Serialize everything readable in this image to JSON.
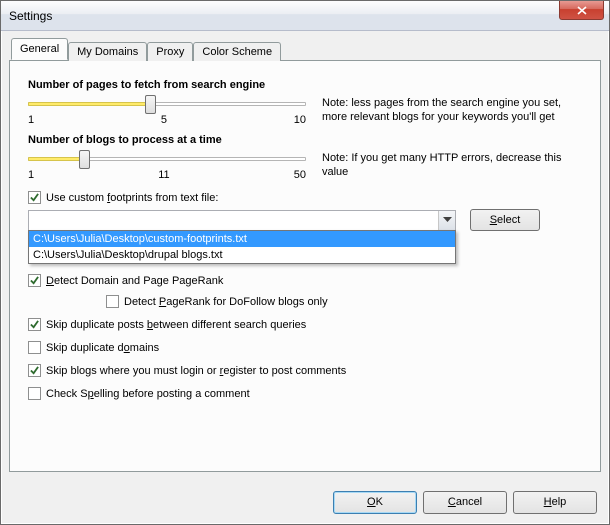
{
  "window": {
    "title": "Settings"
  },
  "tabs": [
    {
      "label": "General",
      "active": true
    },
    {
      "label": "My Domains",
      "active": false
    },
    {
      "label": "Proxy",
      "active": false
    },
    {
      "label": "Color Scheme",
      "active": false
    }
  ],
  "pages_slider": {
    "label": "Number of pages to fetch from search engine",
    "min": "1",
    "mid": "5",
    "max": "10",
    "note": "Note: less pages from the search engine you set, more relevant blogs for your keywords you'll get",
    "value_pct": 44
  },
  "blogs_slider": {
    "label": "Number of blogs to process at a time",
    "min": "1",
    "mid": "11",
    "max": "50",
    "note": "Note: If you get many HTTP errors, decrease this value",
    "value_pct": 20
  },
  "footprints": {
    "checkbox_label_pre": "Use custom ",
    "checkbox_label_u": "f",
    "checkbox_label_post": "ootprints from text file:",
    "checked": true,
    "select_btn_pre": "",
    "select_btn_u": "S",
    "select_btn_post": "elect",
    "dropdown": [
      "C:\\Users\\Julia\\Desktop\\custom-footprints.txt",
      "C:\\Users\\Julia\\Desktop\\drupal blogs.txt"
    ],
    "selected_index": 0
  },
  "options": [
    {
      "checked": true,
      "pre": "",
      "u": "D",
      "post": "etect Domain and Page PageRank",
      "indent": false
    },
    {
      "checked": false,
      "pre": "Detect ",
      "u": "P",
      "post": "ageRank for DoFollow blogs only",
      "indent": true
    },
    {
      "checked": true,
      "pre": "Skip duplicate posts ",
      "u": "b",
      "post": "etween different search queries",
      "indent": false
    },
    {
      "checked": false,
      "pre": "Skip duplicate d",
      "u": "o",
      "post": "mains",
      "indent": false
    },
    {
      "checked": true,
      "pre": "Skip blogs where you must login or ",
      "u": "r",
      "post": "egister to post comments",
      "indent": false
    },
    {
      "checked": false,
      "pre": "Check S",
      "u": "p",
      "post": "elling before posting a comment",
      "indent": false
    }
  ],
  "buttons": {
    "ok_u": "O",
    "ok_post": "K",
    "cancel_u": "C",
    "cancel_post": "ancel",
    "help_u": "H",
    "help_post": "elp"
  }
}
